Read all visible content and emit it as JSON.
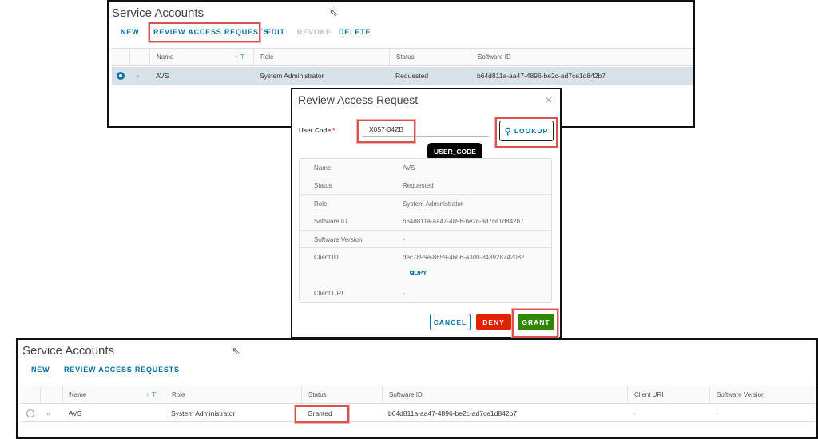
{
  "top_panel": {
    "title": "Service Accounts",
    "toolbar": [
      "NEW",
      "REVIEW ACCESS REQUESTS",
      "EDIT",
      "REVOKE",
      "DELETE"
    ],
    "columns": [
      "Name",
      "Role",
      "Status",
      "Software ID"
    ],
    "row": {
      "name": "AVS",
      "role": "System Administrator",
      "status": "Requested",
      "software_id": "b64d811a-aa47-4896-be2c-ad7ce1d842b7"
    }
  },
  "dialog": {
    "title": "Review Access Request",
    "close": "×",
    "user_code_label": "User Code",
    "required": "*",
    "user_code_value": "X057-34ZB",
    "tooltip": "USER_CODE",
    "lookup": "LOOKUP",
    "details": [
      {
        "label": "Name",
        "value": "AVS"
      },
      {
        "label": "Status",
        "value": "Requested"
      },
      {
        "label": "Role",
        "value": "System Administrator"
      },
      {
        "label": "Software ID",
        "value": "b64d811a-aa47-4896-be2c-ad7ce1d842b7"
      },
      {
        "label": "Software Version",
        "value": "-"
      },
      {
        "label": "Client ID",
        "value": "dec7899a-8659-4606-a3d0-343928742082"
      },
      {
        "label": "Client URI",
        "value": "-"
      }
    ],
    "copy": "COPY",
    "cancel": "CANCEL",
    "deny": "DENY",
    "grant": "GRANT"
  },
  "bottom_panel": {
    "title": "Service Accounts",
    "toolbar": [
      "NEW",
      "REVIEW ACCESS REQUESTS"
    ],
    "columns": [
      "Name",
      "Role",
      "Status",
      "Software ID",
      "Client URI",
      "Software Version"
    ],
    "row": {
      "name": "AVS",
      "role": "System Administrator",
      "status": "Granted",
      "software_id": "b64d811a-aa47-4896-be2c-ad7ce1d842b7",
      "client_uri": "-",
      "software_version": "-"
    }
  },
  "colors": {
    "accent": "#0072a3",
    "deny": "#e12200",
    "grant": "#318700",
    "highlight": "#d9534f"
  }
}
